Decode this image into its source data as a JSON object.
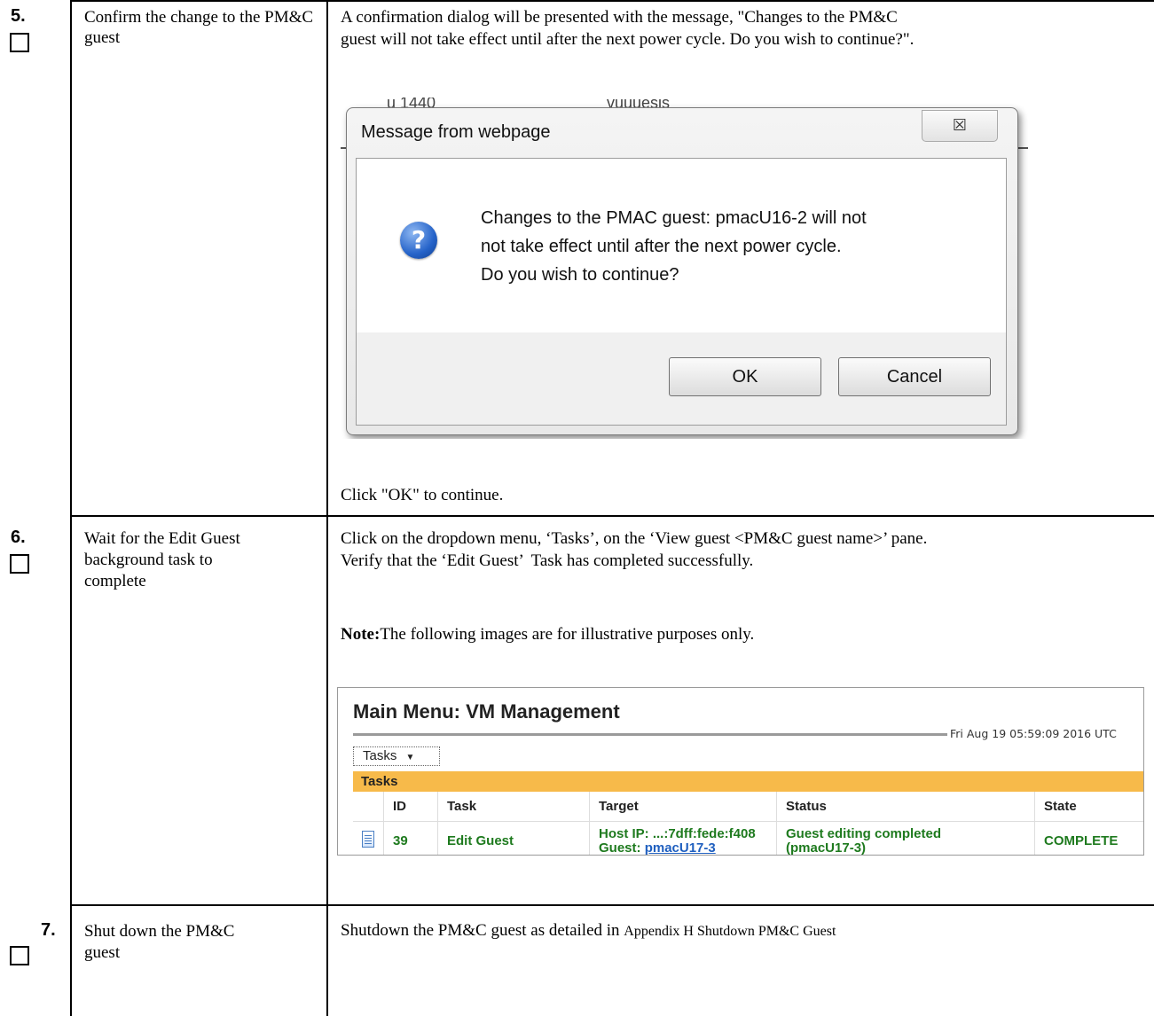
{
  "steps": [
    {
      "number": "5.",
      "title": "Confirm the change to the PM&C guest",
      "intro_line1": "A confirmation dialog will be presented with the message, \"Changes to the PM&C",
      "intro_line2": "guest will not take effect until after the next power cycle. Do you wish to continue?\".",
      "footer_instruction": "Click \"OK\" to continue."
    },
    {
      "number": "6.",
      "title_line1": "Wait for the Edit Guest",
      "title_line2": "background task to",
      "title_line3": "complete",
      "body_line1": "Click on the dropdown menu, ‘Tasks’, on the ‘View guest <PM&C guest name>’ pane.",
      "body_line2": "Verify that the ‘Edit Guest’  Task has completed successfully.",
      "note_label": "Note:",
      "note_text": "The following images are for illustrative purposes only."
    },
    {
      "number": "7.",
      "title_line1": "Shut down the PM&C",
      "title_line2": "guest",
      "body_text": "Shutdown the PM&C guest as detailed in ",
      "body_ref": "Appendix H Shutdown PM&C Guest"
    }
  ],
  "dialog": {
    "background_fragment_1": "u 1440",
    "background_fragment_2": "vuuuesis",
    "title": "Message from webpage",
    "close_glyph": "☒",
    "icon": "question-icon",
    "message_line1": "Changes to the PMAC guest: pmacU16-2 will not",
    "message_line2": "not take effect until after the next power cycle.",
    "message_line3": "Do you wish to continue?",
    "ok_label": "OK",
    "cancel_label": "Cancel"
  },
  "tasks_panel": {
    "title": "Main Menu: VM Management",
    "timestamp": "Fri Aug 19 05:59:09 2016 UTC",
    "tasks_button": "Tasks",
    "tasks_button_arrow": "▼",
    "bar_title": "Tasks",
    "columns": [
      "ID",
      "Task",
      "Target",
      "Status",
      "State"
    ],
    "row": {
      "id": "39",
      "task": "Edit Guest",
      "target_line1": "Host IP: ...:7dff:fede:f408",
      "target_guest_label": "Guest: ",
      "target_guest_link": "pmacU17-3",
      "status_line1": "Guest editing completed",
      "status_line2": "(pmacU17-3)",
      "state": "COMPLETE"
    }
  }
}
